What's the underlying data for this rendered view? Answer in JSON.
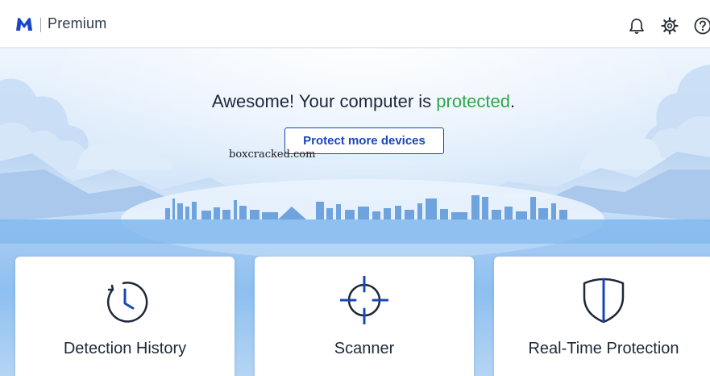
{
  "header": {
    "logo": "malwarebytes-m-logo",
    "title": "Premium",
    "icons": [
      "bell-icon",
      "gear-icon",
      "help-icon"
    ]
  },
  "hero": {
    "headline_prefix": "Awesome! Your computer is ",
    "headline_status": "protected",
    "headline_suffix": ".",
    "cta_label": "Protect more devices",
    "watermark": "boxcracked.com"
  },
  "cards": [
    {
      "label": "Detection History",
      "icon": "clock-history-icon"
    },
    {
      "label": "Scanner",
      "icon": "crosshair-icon"
    },
    {
      "label": "Real-Time Protection",
      "icon": "shield-icon"
    }
  ],
  "colors": {
    "brand": "#1946b8",
    "status_ok": "#2fa64a",
    "text": "#1d2838"
  }
}
